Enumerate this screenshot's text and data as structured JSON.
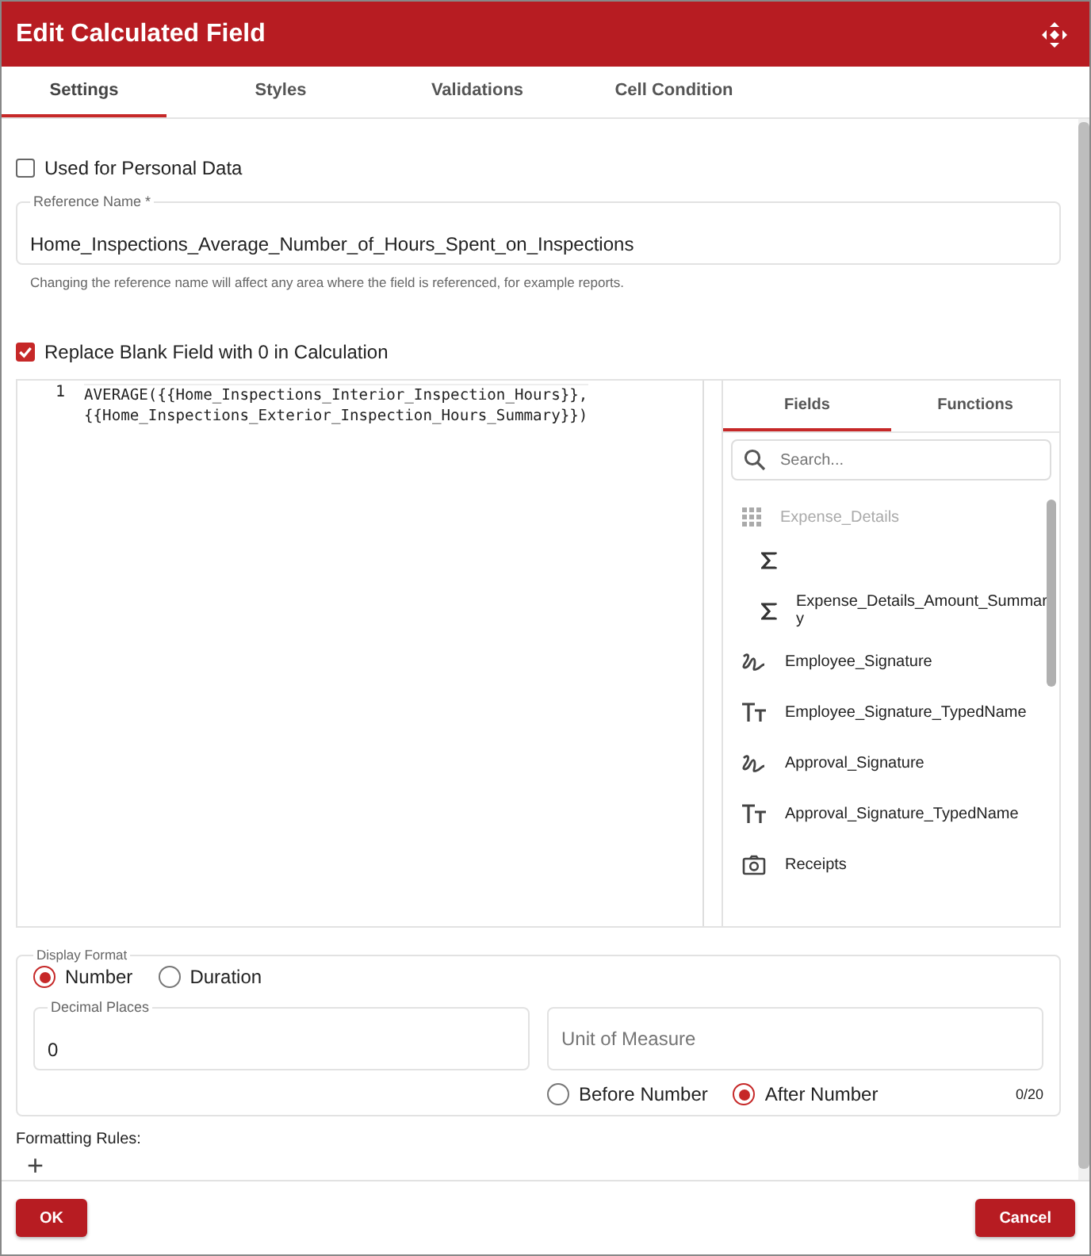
{
  "window": {
    "title": "Edit Calculated Field"
  },
  "tabs": [
    {
      "label": "Settings",
      "selected": true
    },
    {
      "label": "Styles",
      "selected": false
    },
    {
      "label": "Validations",
      "selected": false
    },
    {
      "label": "Cell Condition",
      "selected": false
    }
  ],
  "personal_data": {
    "label": "Used for Personal Data",
    "checked": false
  },
  "reference_name": {
    "label": "Reference Name *",
    "value": "Home_Inspections_Average_Number_of_Hours_Spent_on_Inspections",
    "hint": "Changing the reference name will affect any area where the field is referenced, for example reports."
  },
  "replace_blank": {
    "label": "Replace Blank Field with 0 in Calculation",
    "checked": true
  },
  "editor": {
    "line_number": "1",
    "lines": [
      "AVERAGE({{Home_Inspections_Interior_Inspection_Hours}},",
      "{{Home_Inspections_Exterior_Inspection_Hours_Summary}})"
    ]
  },
  "picker": {
    "tabs": [
      {
        "label": "Fields",
        "selected": true
      },
      {
        "label": "Functions",
        "selected": false
      }
    ],
    "search": {
      "placeholder": "Search..."
    },
    "items": [
      {
        "kind": "group",
        "name": "Expense_Details",
        "disabled": true,
        "children": [
          {
            "kind": "sum"
          },
          {
            "kind": "sum",
            "name": "Expense_Details_Amount_Summar y"
          }
        ]
      },
      {
        "kind": "signature",
        "name": "Employee_Signature"
      },
      {
        "kind": "text",
        "name": "Employee_Signature_TypedName"
      },
      {
        "kind": "signature",
        "name": "Approval_Signature"
      },
      {
        "kind": "text",
        "name": "Approval_Signature_TypedName"
      },
      {
        "kind": "image",
        "name": "Receipts"
      }
    ]
  },
  "display_format": {
    "legend": "Display Format",
    "options": [
      {
        "label": "Number",
        "selected": true
      },
      {
        "label": "Duration",
        "selected": false
      }
    ],
    "decimal_places": {
      "label": "Decimal Places",
      "value": "0"
    },
    "unit": {
      "placeholder": "Unit of Measure",
      "counter": "0/20"
    },
    "position": [
      {
        "label": "Before Number",
        "selected": false
      },
      {
        "label": "After Number",
        "selected": true
      }
    ]
  },
  "formatting_rules": {
    "label": "Formatting Rules:",
    "add": "+"
  },
  "buttons": [
    {
      "label": "OK"
    },
    {
      "label": "Cancel"
    }
  ]
}
